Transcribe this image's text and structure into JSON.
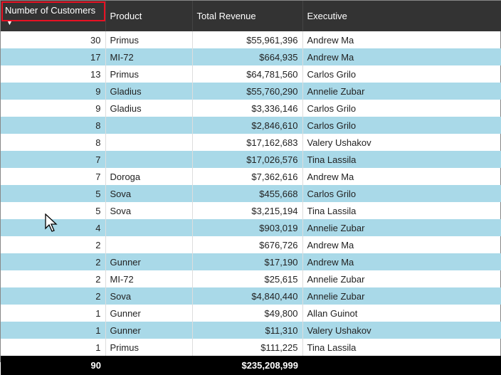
{
  "columns": [
    {
      "key": "customers",
      "label": "Number of Customers",
      "align": "num",
      "sorted_desc": true
    },
    {
      "key": "product",
      "label": "Product",
      "align": "txt"
    },
    {
      "key": "revenue",
      "label": "Total Revenue",
      "align": "num"
    },
    {
      "key": "executive",
      "label": "Executive",
      "align": "txt"
    }
  ],
  "rows": [
    {
      "customers": "30",
      "product": "Primus",
      "revenue": "$55,961,396",
      "executive": "Andrew Ma"
    },
    {
      "customers": "17",
      "product": "MI-72",
      "revenue": "$664,935",
      "executive": "Andrew Ma"
    },
    {
      "customers": "13",
      "product": "Primus",
      "revenue": "$64,781,560",
      "executive": "Carlos Grilo"
    },
    {
      "customers": "9",
      "product": "Gladius",
      "revenue": "$55,760,290",
      "executive": "Annelie Zubar"
    },
    {
      "customers": "9",
      "product": "Gladius",
      "revenue": "$3,336,146",
      "executive": "Carlos Grilo"
    },
    {
      "customers": "8",
      "product": "",
      "revenue": "$2,846,610",
      "executive": "Carlos Grilo"
    },
    {
      "customers": "8",
      "product": "",
      "revenue": "$17,162,683",
      "executive": "Valery Ushakov"
    },
    {
      "customers": "7",
      "product": "",
      "revenue": "$17,026,576",
      "executive": "Tina Lassila"
    },
    {
      "customers": "7",
      "product": "Doroga",
      "revenue": "$7,362,616",
      "executive": "Andrew Ma"
    },
    {
      "customers": "5",
      "product": "Sova",
      "revenue": "$455,668",
      "executive": "Carlos Grilo"
    },
    {
      "customers": "5",
      "product": "Sova",
      "revenue": "$3,215,194",
      "executive": "Tina Lassila"
    },
    {
      "customers": "4",
      "product": "",
      "revenue": "$903,019",
      "executive": "Annelie Zubar"
    },
    {
      "customers": "2",
      "product": "",
      "revenue": "$676,726",
      "executive": "Andrew Ma"
    },
    {
      "customers": "2",
      "product": "Gunner",
      "revenue": "$17,190",
      "executive": "Andrew Ma"
    },
    {
      "customers": "2",
      "product": "MI-72",
      "revenue": "$25,615",
      "executive": "Annelie Zubar"
    },
    {
      "customers": "2",
      "product": "Sova",
      "revenue": "$4,840,440",
      "executive": "Annelie Zubar"
    },
    {
      "customers": "1",
      "product": "Gunner",
      "revenue": "$49,800",
      "executive": "Allan Guinot"
    },
    {
      "customers": "1",
      "product": "Gunner",
      "revenue": "$11,310",
      "executive": "Valery Ushakov"
    },
    {
      "customers": "1",
      "product": "Primus",
      "revenue": "$111,225",
      "executive": "Tina Lassila"
    }
  ],
  "totals": {
    "customers": "90",
    "revenue": "$235,208,999"
  }
}
